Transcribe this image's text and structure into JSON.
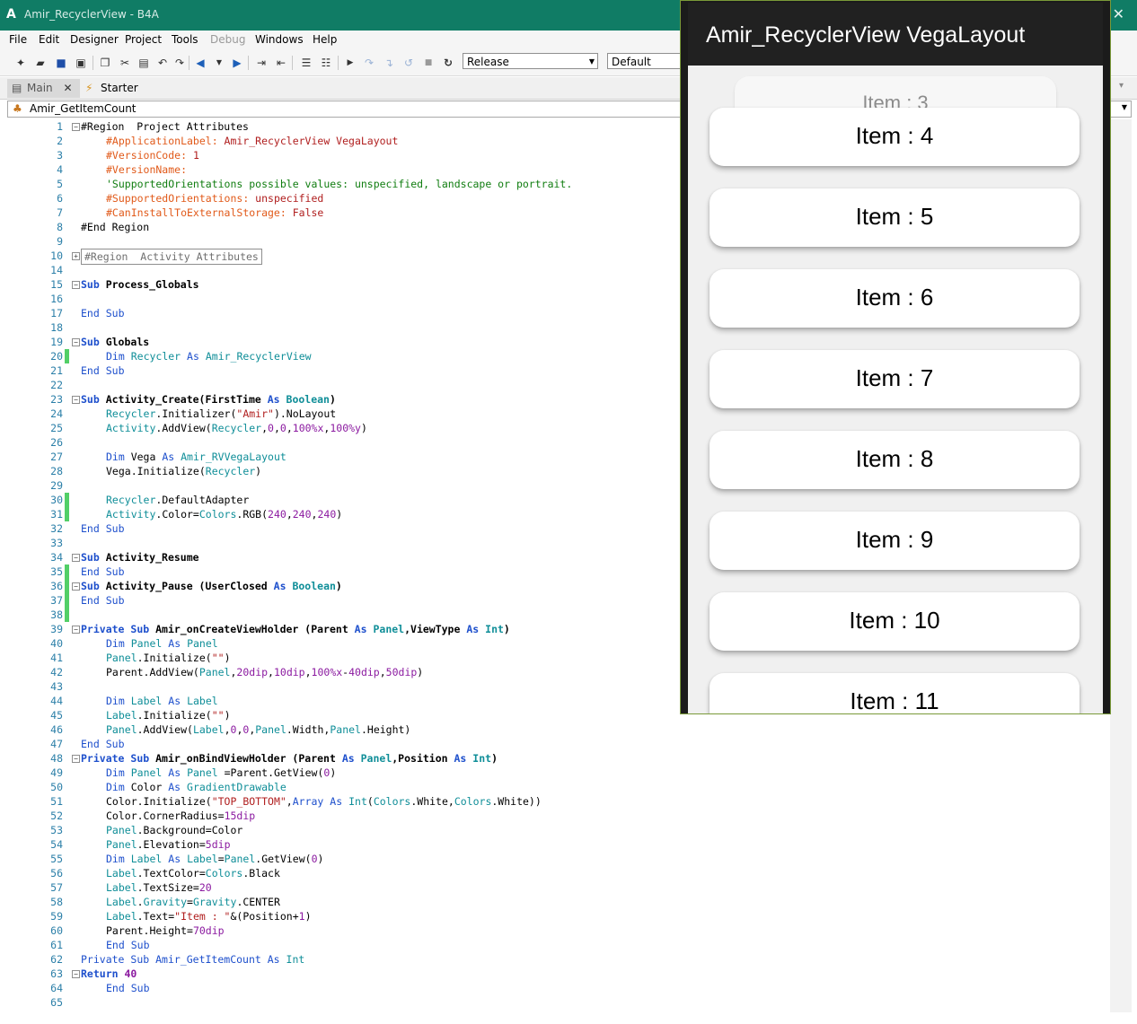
{
  "window": {
    "app_icon": "A",
    "title": "Amir_RecyclerView - B4A",
    "close_glyph": "✕"
  },
  "menu": [
    "File",
    "Edit",
    "Designer",
    "Project",
    "Tools",
    "Debug",
    "Windows",
    "Help"
  ],
  "menu_disabled": [
    "Debug"
  ],
  "toolbar": {
    "build_config": "Release",
    "device_config": "Default"
  },
  "tabs": [
    {
      "label": "Main",
      "close": "✕",
      "active": true
    },
    {
      "label": "Starter",
      "active": false
    }
  ],
  "module_selector": {
    "value": "Amir_GetItemCount"
  },
  "emulator": {
    "app_title": "Amir_RecyclerView VegaLayout",
    "items": [
      "Item : 3",
      "Item : 4",
      "Item : 5",
      "Item : 6",
      "Item : 7",
      "Item : 8",
      "Item : 9",
      "Item : 10",
      "Item : 11"
    ]
  },
  "colors": {
    "titlebar": "#107c65",
    "keyword": "#1d4fcc",
    "type": "#0f8e98",
    "number": "#8b1aa0",
    "string": "#b01e1e",
    "directive": "#e15a1a",
    "comment": "#107d10",
    "change_marker": "#52cf67"
  },
  "code_lines": [
    {
      "n": 1,
      "text": "#Region  Project Attributes"
    },
    {
      "n": 2,
      "text": "#ApplicationLabel: Amir_RecyclerView VegaLayout"
    },
    {
      "n": 3,
      "text": "#VersionCode: 1"
    },
    {
      "n": 4,
      "text": "#VersionName:"
    },
    {
      "n": 5,
      "text": "'SupportedOrientations possible values: unspecified, landscape or portrait."
    },
    {
      "n": 6,
      "text": "#SupportedOrientations: unspecified"
    },
    {
      "n": 7,
      "text": "#CanInstallToExternalStorage: False"
    },
    {
      "n": 8,
      "text": "#End Region"
    },
    {
      "n": 9,
      "text": ""
    },
    {
      "n": 10,
      "text": "#Region  Activity Attributes"
    },
    {
      "n": 14,
      "text": ""
    },
    {
      "n": 15,
      "text": "Sub Process_Globals"
    },
    {
      "n": 16,
      "text": ""
    },
    {
      "n": 17,
      "text": "End Sub"
    },
    {
      "n": 18,
      "text": ""
    },
    {
      "n": 19,
      "text": "Sub Globals"
    },
    {
      "n": 20,
      "text": "Dim Recycler As Amir_RecyclerView"
    },
    {
      "n": 21,
      "text": "End Sub"
    },
    {
      "n": 22,
      "text": ""
    },
    {
      "n": 23,
      "text": "Sub Activity_Create(FirstTime As Boolean)"
    },
    {
      "n": 24,
      "text": "Recycler.Initializer(\"Amir\").NoLayout"
    },
    {
      "n": 25,
      "text": "Activity.AddView(Recycler,0,0,100%x,100%y)"
    },
    {
      "n": 26,
      "text": ""
    },
    {
      "n": 27,
      "text": "Dim Vega As Amir_RVVegaLayout"
    },
    {
      "n": 28,
      "text": "Vega.Initialize(Recycler)"
    },
    {
      "n": 29,
      "text": ""
    },
    {
      "n": 30,
      "text": "Recycler.DefaultAdapter"
    },
    {
      "n": 31,
      "text": "Activity.Color=Colors.RGB(240,240,240)"
    },
    {
      "n": 32,
      "text": "End Sub"
    },
    {
      "n": 33,
      "text": ""
    },
    {
      "n": 34,
      "text": "Sub Activity_Resume"
    },
    {
      "n": 35,
      "text": "End Sub"
    },
    {
      "n": 36,
      "text": "Sub Activity_Pause (UserClosed As Boolean)"
    },
    {
      "n": 37,
      "text": "End Sub"
    },
    {
      "n": 38,
      "text": ""
    },
    {
      "n": 39,
      "text": "Private Sub Amir_onCreateViewHolder (Parent As Panel,ViewType As Int)"
    },
    {
      "n": 40,
      "text": "Dim Panel As Panel"
    },
    {
      "n": 41,
      "text": "Panel.Initialize(\"\")"
    },
    {
      "n": 42,
      "text": "Parent.AddView(Panel,20dip,10dip,100%x-40dip,50dip)"
    },
    {
      "n": 43,
      "text": ""
    },
    {
      "n": 44,
      "text": "Dim Label As Label"
    },
    {
      "n": 45,
      "text": "Label.Initialize(\"\")"
    },
    {
      "n": 46,
      "text": "Panel.AddView(Label,0,0,Panel.Width,Panel.Height)"
    },
    {
      "n": 47,
      "text": "End Sub"
    },
    {
      "n": 48,
      "text": "Private Sub Amir_onBindViewHolder (Parent As Panel,Position As Int)"
    },
    {
      "n": 49,
      "text": "Dim Panel As Panel =Parent.GetView(0)"
    },
    {
      "n": 50,
      "text": "Dim Color As GradientDrawable"
    },
    {
      "n": 51,
      "text": "Color.Initialize(\"TOP_BOTTOM\",Array As Int(Colors.White,Colors.White))"
    },
    {
      "n": 52,
      "text": "Color.CornerRadius=15dip"
    },
    {
      "n": 53,
      "text": "Panel.Background=Color"
    },
    {
      "n": 54,
      "text": "Panel.Elevation=5dip"
    },
    {
      "n": 55,
      "text": "Dim Label As Label=Panel.GetView(0)"
    },
    {
      "n": 56,
      "text": "Label.TextColor=Colors.Black"
    },
    {
      "n": 57,
      "text": "Label.TextSize=20"
    },
    {
      "n": 58,
      "text": "Label.Gravity=Gravity.CENTER"
    },
    {
      "n": 59,
      "text": "Label.Text=\"Item : \"&(Position+1)"
    },
    {
      "n": 60,
      "text": "Parent.Height=70dip"
    },
    {
      "n": 61,
      "text": "End Sub"
    },
    {
      "n": 62,
      "text": "Private Sub Amir_GetItemCount As Int"
    },
    {
      "n": 63,
      "text": "Return 40"
    },
    {
      "n": 64,
      "text": "End Sub"
    },
    {
      "n": 65,
      "text": ""
    }
  ]
}
